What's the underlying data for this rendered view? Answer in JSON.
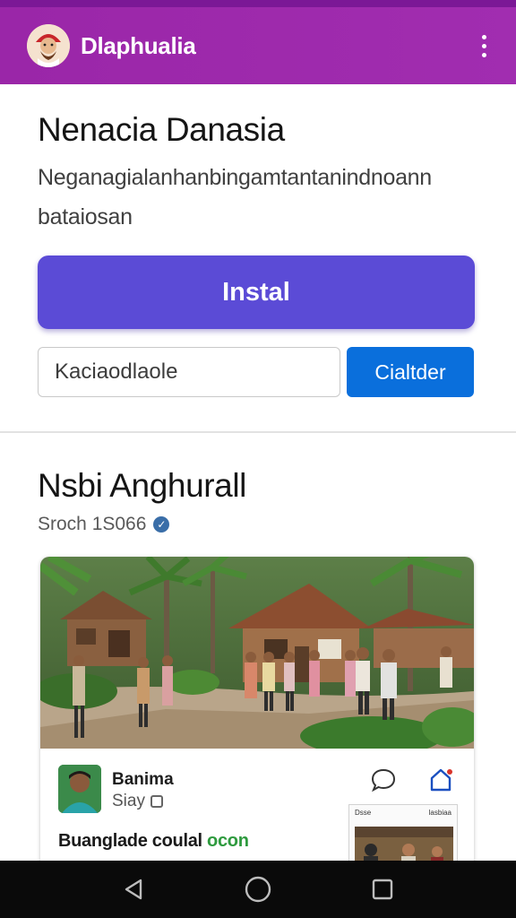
{
  "app_bar": {
    "title": "Dlaphualia",
    "logo_icon": "mascot-logo-icon",
    "overflow_icon": "more-vert-icon",
    "color": "#9a26a8"
  },
  "install": {
    "title": "Nenacia Danasia",
    "description": "Neganagialanhanbingamtantanindnoann bataiosan",
    "install_label": "Instal",
    "install_color": "#5b4bd6",
    "search_placeholder": "Kaciaodlaole",
    "calendar_label": "Cialtder",
    "calendar_color": "#0a6fdc"
  },
  "feed": {
    "title": "Nsbi Anghurall",
    "meta": "Sroch 1S066",
    "verified_icon": "verified-badge-icon",
    "post": {
      "author_name": "Banima",
      "author_sub": "Siay",
      "caption_text": "Buanglade coulal ",
      "caption_tag": "ocon",
      "comment_icon": "comment-bubble-icon",
      "share_icon": "share-icon",
      "preview_left": "Dsse",
      "preview_right": "lasbiaa"
    }
  },
  "nav_bar": {
    "back_icon": "back-triangle-icon",
    "home_icon": "home-circle-icon",
    "recents_icon": "recents-square-icon"
  }
}
